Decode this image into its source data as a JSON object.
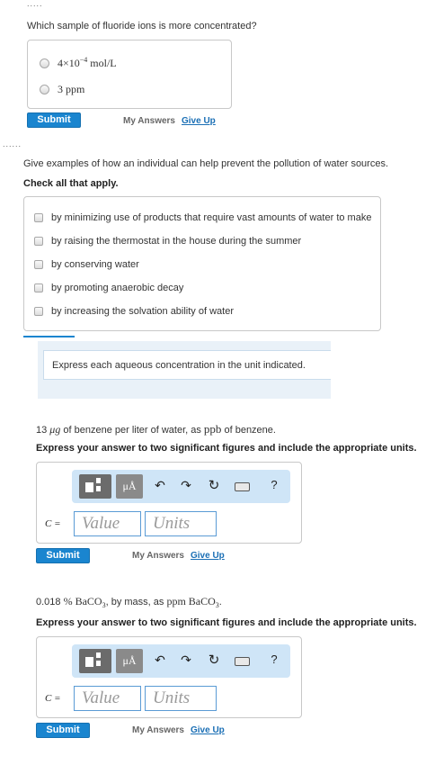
{
  "q1": {
    "prompt": "Which sample of fluoride ions is more concentrated?",
    "options": [
      {
        "prefix": "4×10",
        "exp": "−4",
        "unit": " mol/L"
      },
      {
        "prefix": "3 ppm",
        "exp": "",
        "unit": ""
      }
    ],
    "submit_label": "Submit",
    "my_answers_label": "My Answers",
    "give_up_label": "Give Up"
  },
  "q2": {
    "prompt": "Give examples of how an individual can help prevent the pollution of water sources.",
    "instruction": "Check all that apply.",
    "options": [
      "by minimizing use of products that require vast amounts of water to make",
      "by raising the thermostat in the house during the summer",
      "by conserving water",
      "by promoting anaerobic decay",
      "by increasing the solvation ability of water"
    ]
  },
  "info_box": {
    "text": "Express each aqueous concentration in the unit indicated."
  },
  "partA": {
    "amount": "13 ",
    "unit_mu": "μg",
    "mid_text": " of benzene per liter of water, as ",
    "target_unit": "ppb",
    "end_text": " of benzene.",
    "instruction": "Express your answer to two significant figures and include the appropriate units.",
    "toolbar": {
      "mu_label": "μÅ",
      "help_label": "?"
    },
    "variable_label": "C =",
    "value_placeholder": "Value",
    "units_placeholder": "Units",
    "submit_label": "Submit",
    "my_answers_label": "My Answers",
    "give_up_label": "Give Up"
  },
  "partB": {
    "amount": "0.018 ",
    "percent": "%",
    "compound": " BaCO",
    "compound_sub": "3",
    "mid_text": ", by mass, as ",
    "target_unit": "ppm BaCO",
    "target_sub": "3",
    "end_text": ".",
    "instruction": "Express your answer to two significant figures and include the appropriate units.",
    "toolbar": {
      "mu_label": "μÅ",
      "help_label": "?"
    },
    "variable_label": "C =",
    "value_placeholder": "Value",
    "units_placeholder": "Units",
    "submit_label": "Submit",
    "my_answers_label": "My Answers",
    "give_up_label": "Give Up"
  },
  "colors": {
    "submit": "#1a85cf",
    "link": "#1a6fb5",
    "toolbar": "#cfe5f7",
    "field_border": "#5a9bd5"
  }
}
